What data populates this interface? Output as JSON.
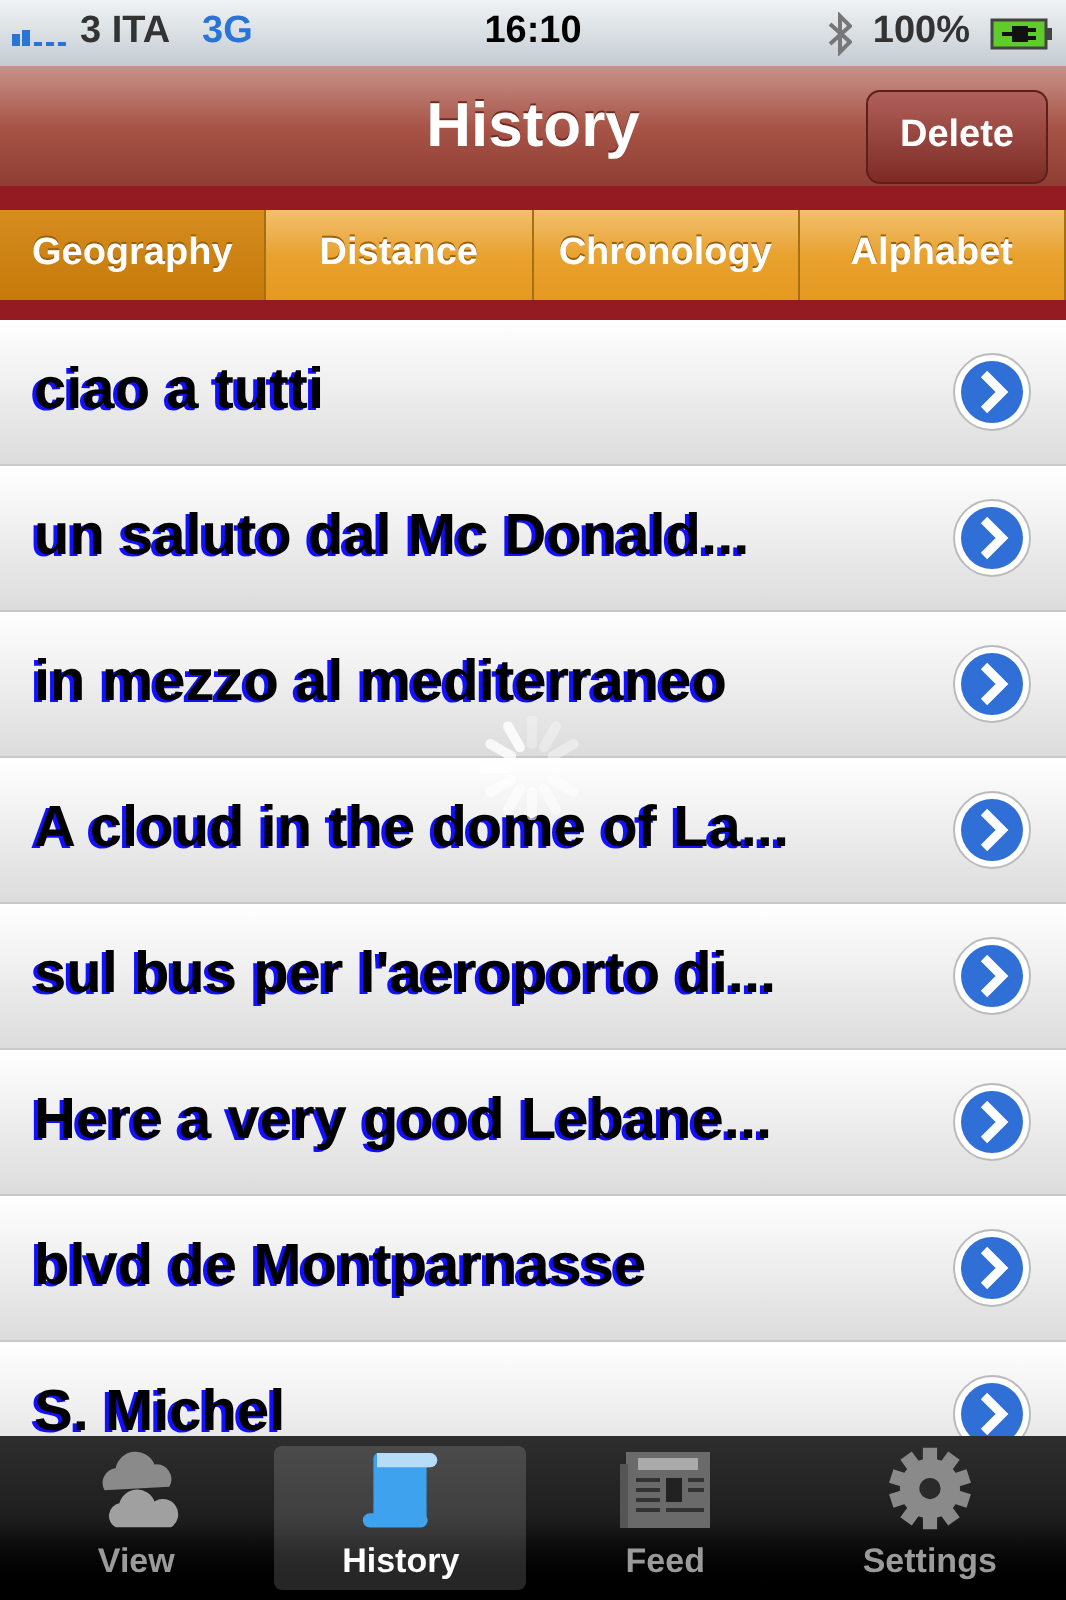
{
  "status_bar": {
    "carrier": "3 ITA",
    "network": "3G",
    "time": "16:10",
    "battery": "100%"
  },
  "nav_bar": {
    "title": "History",
    "right_button": "Delete"
  },
  "segments": [
    {
      "label": "Geography",
      "selected": true
    },
    {
      "label": "Distance",
      "selected": false
    },
    {
      "label": "Chronology",
      "selected": false
    },
    {
      "label": "Alphabet",
      "selected": false
    }
  ],
  "loading": true,
  "rows": [
    {
      "title": "ciao a tutti"
    },
    {
      "title": "un saluto dal Mc Donald..."
    },
    {
      "title": "in mezzo al mediterraneo"
    },
    {
      "title": "A cloud in the dome of La..."
    },
    {
      "title": "sul bus per l'aeroporto di..."
    },
    {
      "title": "Here a very good Lebane..."
    },
    {
      "title": "blvd de Montparnasse"
    },
    {
      "title": "S. Michel"
    }
  ],
  "tab_bar": [
    {
      "label": "View",
      "selected": false
    },
    {
      "label": "History",
      "selected": true
    },
    {
      "label": "Feed",
      "selected": false
    },
    {
      "label": "Settings",
      "selected": false
    }
  ]
}
